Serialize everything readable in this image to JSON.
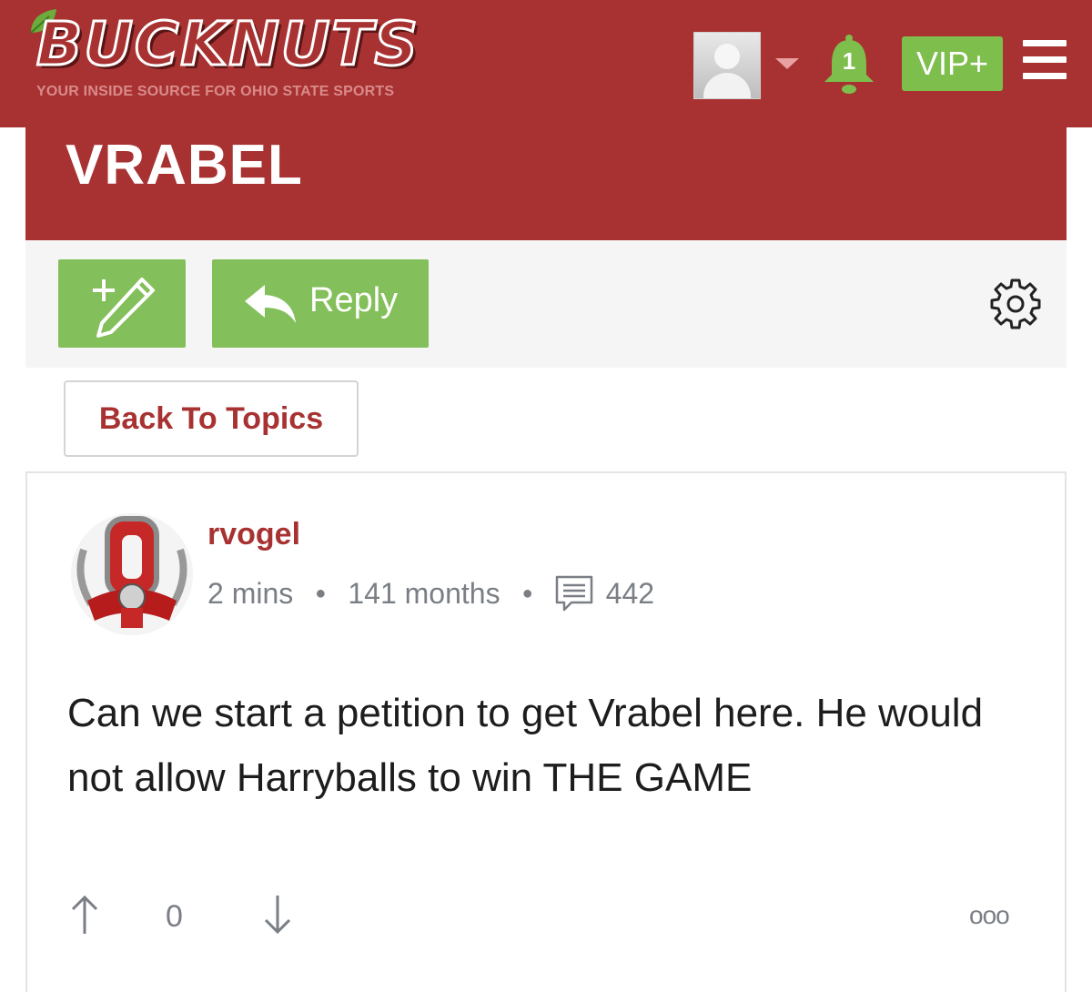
{
  "header": {
    "logo_text": "BUCKNUTS",
    "tagline": "YOUR INSIDE SOURCE FOR OHIO STATE SPORTS",
    "notification_count": "1",
    "vip_label": "VIP+",
    "icons": [
      "avatar",
      "chevron-down-icon",
      "bell-icon",
      "menu-icon"
    ],
    "colors": {
      "brand": "#a83232",
      "accent": "#7ebe4c"
    }
  },
  "topic": {
    "title": "VRABEL"
  },
  "toolbar": {
    "reply_label": "Reply",
    "icons": [
      "new-post-icon",
      "reply-arrow-icon",
      "gear-icon"
    ]
  },
  "nav": {
    "back_label": "Back To Topics"
  },
  "post": {
    "username": "rvogel",
    "time_ago": "2 mins",
    "member_age": "141 months",
    "post_count": "442",
    "body": "Can we start a petition to get Vrabel here. He would not allow Harryballs to win THE GAME",
    "vote_count": "0",
    "more_label": "ooo"
  }
}
